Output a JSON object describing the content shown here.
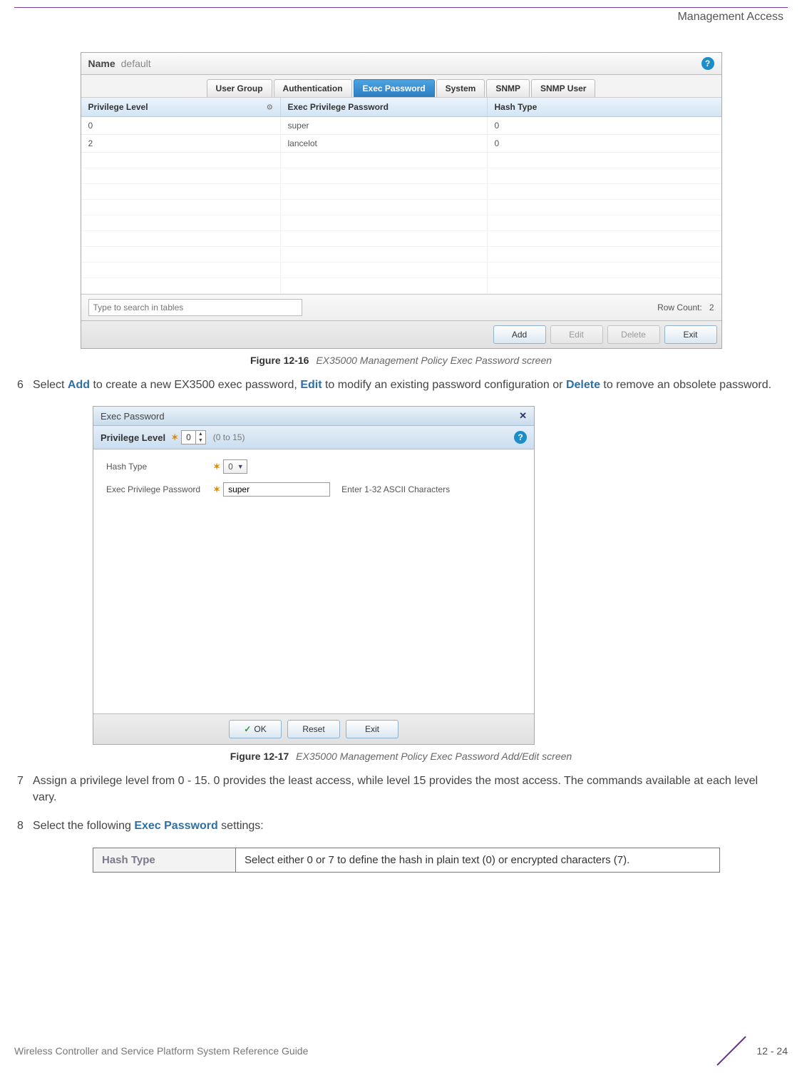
{
  "header": {
    "title": "Management Access"
  },
  "fig1": {
    "name_label": "Name",
    "name_value": "default",
    "tabs": [
      {
        "label": "User Group",
        "active": false
      },
      {
        "label": "Authentication",
        "active": false
      },
      {
        "label": "Exec Password",
        "active": true
      },
      {
        "label": "System",
        "active": false
      },
      {
        "label": "SNMP",
        "active": false
      },
      {
        "label": "SNMP User",
        "active": false
      }
    ],
    "columns": {
      "c1": "Privilege Level",
      "c2": "Exec Privilege Password",
      "c3": "Hash Type"
    },
    "rows": [
      {
        "priv": "0",
        "pwd": "super",
        "hash": "0"
      },
      {
        "priv": "2",
        "pwd": "lancelot",
        "hash": "0"
      }
    ],
    "search_placeholder": "Type to search in tables",
    "row_count_label": "Row Count:",
    "row_count_value": "2",
    "buttons": {
      "add": "Add",
      "edit": "Edit",
      "delete": "Delete",
      "exit": "Exit"
    },
    "caption_bold": "Figure 12-16",
    "caption_em": "EX35000 Management Policy Exec Password screen"
  },
  "step6": {
    "num": "6",
    "pre": "Select ",
    "kw_add": "Add",
    "mid1": " to create a new EX3500 exec password, ",
    "kw_edit": "Edit",
    "mid2": " to modify an existing password configuration or ",
    "kw_delete": "Delete",
    "post": " to remove an obsolete password."
  },
  "fig2": {
    "title": "Exec Password",
    "priv_label": "Privilege Level",
    "priv_value": "0",
    "priv_range": "(0 to 15)",
    "hash_label": "Hash Type",
    "hash_value": "0",
    "pwd_label": "Exec Privilege Password",
    "pwd_value": "super",
    "pwd_hint": "Enter 1-32 ASCII Characters",
    "buttons": {
      "ok": "OK",
      "reset": "Reset",
      "exit": "Exit"
    },
    "caption_bold": "Figure 12-17",
    "caption_em": "EX35000 Management Policy Exec Password Add/Edit screen"
  },
  "step7": {
    "num": "7",
    "text": "Assign a privilege level from 0 - 15. 0 provides the least access, while level 15 provides the most access. The commands available at each level vary."
  },
  "step8": {
    "num": "8",
    "pre": "Select the following ",
    "kw": "Exec Password",
    "post": " settings:"
  },
  "settings_table": {
    "key": "Hash Type",
    "val": "Select either 0 or 7 to define the hash in plain text (0) or encrypted characters (7)."
  },
  "footer": {
    "title": "Wireless Controller and Service Platform System Reference Guide",
    "page": "12 - 24"
  }
}
